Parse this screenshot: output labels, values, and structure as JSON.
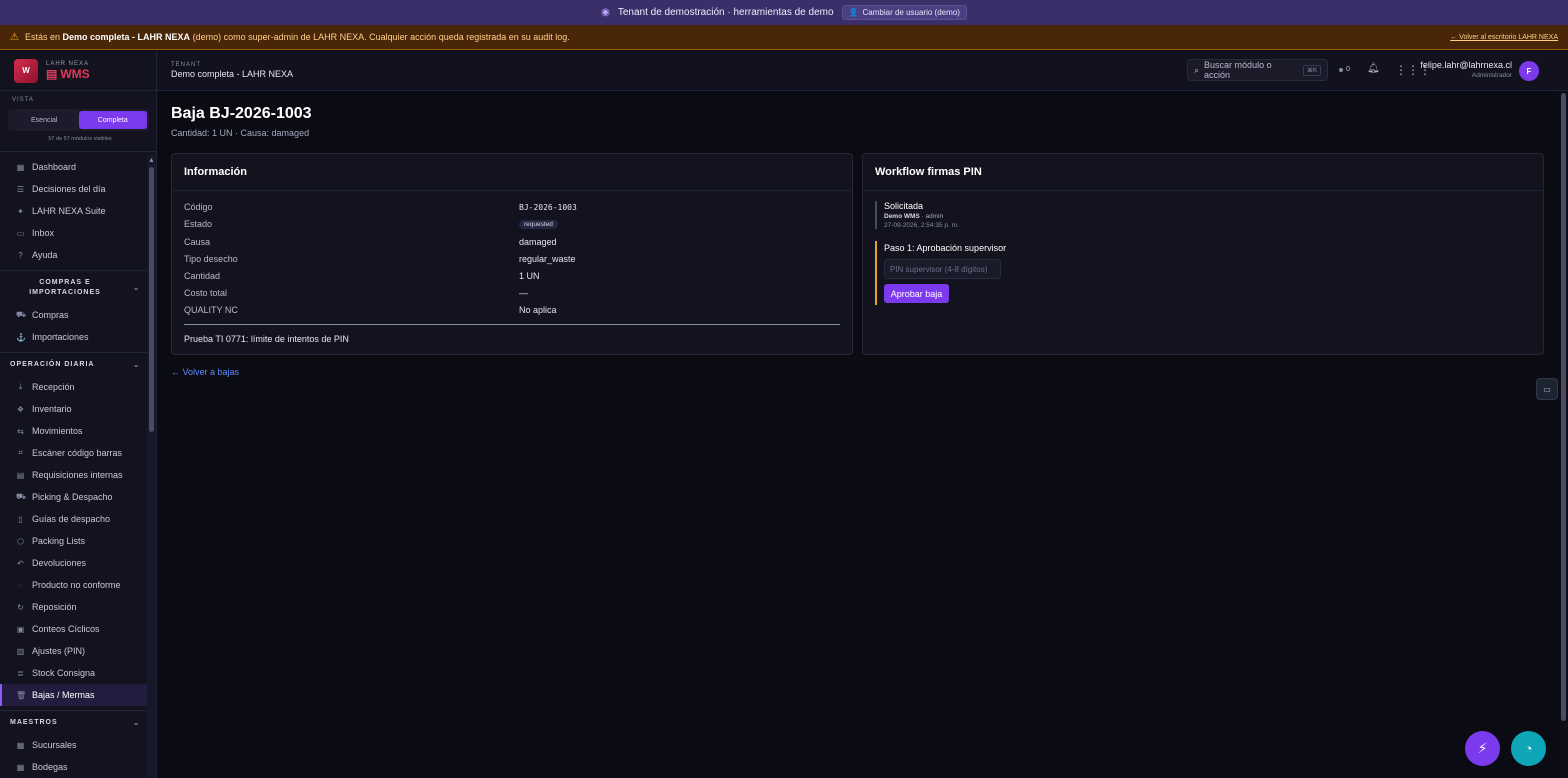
{
  "tenant_bar": {
    "text": "Tenant de demostración · herramientas de demo",
    "switch_label": "Cambiar de usuario (demo)"
  },
  "warning_bar": {
    "prefix": "Estás en ",
    "tenant": "Demo completa - LAHR NEXA",
    "demo_tag": " (demo) ",
    "suffix": "como super-admin de LAHR NEXA. Cualquier acción queda registrada en su audit log.",
    "back_link": "← Volver al escritorio LAHR NEXA"
  },
  "brand": {
    "company": "LAHR NEXA",
    "product": "WMS"
  },
  "vista": {
    "label": "VISTA",
    "options": [
      "Esencial",
      "Completa"
    ],
    "active": "Completa",
    "count": "57 de 57 módulos visibles"
  },
  "nav": {
    "top": [
      {
        "label": "Dashboard",
        "icon": "grid-icon"
      },
      {
        "label": "Decisiones del día",
        "icon": "list-check-icon"
      },
      {
        "label": "LAHR NEXA Suite",
        "icon": "sparkle-icon"
      },
      {
        "label": "Inbox",
        "icon": "inbox-icon"
      },
      {
        "label": "Ayuda",
        "icon": "help-icon"
      }
    ],
    "section_compras": "COMPRAS E IMPORTACIONES",
    "compras": [
      {
        "label": "Compras",
        "icon": "cart-icon"
      },
      {
        "label": "Importaciones",
        "icon": "ship-icon"
      }
    ],
    "section_operacion": "OPERACIÓN DIARIA",
    "operacion": [
      {
        "label": "Recepción",
        "icon": "download-icon"
      },
      {
        "label": "Inventario",
        "icon": "boxes-icon"
      },
      {
        "label": "Movimientos",
        "icon": "arrows-icon"
      },
      {
        "label": "Escáner código barras",
        "icon": "scan-icon"
      },
      {
        "label": "Requisiciones internas",
        "icon": "clipboard-icon"
      },
      {
        "label": "Picking & Despacho",
        "icon": "truck-icon"
      },
      {
        "label": "Guías de despacho",
        "icon": "document-icon"
      },
      {
        "label": "Packing Lists",
        "icon": "package-icon"
      },
      {
        "label": "Devoluciones",
        "icon": "undo-icon"
      },
      {
        "label": "Producto no conforme",
        "icon": "alert-icon"
      },
      {
        "label": "Reposición",
        "icon": "refresh-icon"
      },
      {
        "label": "Conteos Cíclicos",
        "icon": "cycle-icon"
      },
      {
        "label": "Ajustes (PIN)",
        "icon": "lock-clipboard-icon"
      },
      {
        "label": "Stock Consigna",
        "icon": "stack-icon"
      },
      {
        "label": "Bajas / Mermas",
        "icon": "trash-icon"
      }
    ],
    "section_maestros": "MAESTROS",
    "maestros": [
      {
        "label": "Sucursales",
        "icon": "building-icon"
      },
      {
        "label": "Bodegas",
        "icon": "warehouse-icon"
      }
    ]
  },
  "header": {
    "tenant_label": "TENANT",
    "tenant_name": "Demo completa - LAHR NEXA",
    "search_placeholder": "Buscar módulo o acción",
    "search_kbd": "⌘K",
    "online_count": "0",
    "user_email": "felipe.lahr@lahrnexa.cl",
    "user_role": "Administrador",
    "avatar_initial": "F"
  },
  "page": {
    "title": "Baja BJ-2026-1003",
    "subtitle": "Cantidad: 1 UN · Causa: damaged"
  },
  "info_card": {
    "title": "Información",
    "rows": [
      {
        "label": "Código",
        "value": "BJ-2026-1003"
      },
      {
        "label": "Estado",
        "value": "requested"
      },
      {
        "label": "Causa",
        "value": "damaged"
      },
      {
        "label": "Tipo desecho",
        "value": "regular_waste"
      },
      {
        "label": "Cantidad",
        "value": "1 UN"
      },
      {
        "label": "Costo total",
        "value": "—"
      },
      {
        "label": "QUALITY NC",
        "value": "No aplica"
      }
    ],
    "note": "Prueba TI 0771: límite de intentos de PIN"
  },
  "workflow_card": {
    "title": "Workflow firmas PIN",
    "step1_title": "Solicitada",
    "step1_user": "Demo WMS",
    "step1_role": " · admin",
    "step1_date": "27-09-2026, 2:54:35 p. m.",
    "step2_title": "Paso 1: Aprobación supervisor",
    "pin_placeholder": "PIN supervisor (4-8 dígitos)",
    "approve_label": "Aprobar baja"
  },
  "back_link": "← Volver a bajas",
  "colors": {
    "accent": "#7c3aed",
    "warning": "#ffb02e",
    "link": "#5b8cff",
    "teal": "#0ea5b7"
  }
}
